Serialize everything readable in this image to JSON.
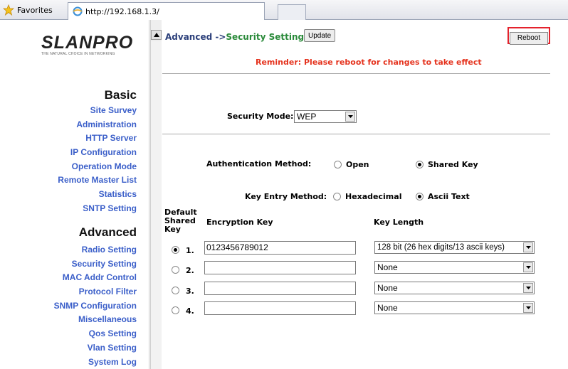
{
  "browser": {
    "favorites_label": "Favorites",
    "tab_url": "http://192.168.1.3/"
  },
  "logo": {
    "name": "SLANPRO",
    "tagline": "THE NATURAL CHOICE IN NETWORKING"
  },
  "sidebar": {
    "basic_heading": "Basic",
    "basic_items": [
      "Site Survey",
      "Administration",
      "HTTP Server",
      "IP Configuration",
      "Operation Mode",
      "Remote Master List",
      "Statistics",
      "SNTP Setting"
    ],
    "advanced_heading": "Advanced",
    "advanced_items": [
      "Radio Setting",
      "Security Setting",
      "MAC Addr Control",
      "Protocol Filter",
      "SNMP Configuration",
      "Miscellaneous",
      "Qos Setting",
      "Vlan Setting",
      "System Log"
    ]
  },
  "header": {
    "crumb_parent": "Advanced ->",
    "crumb_current": "Security Setting",
    "update_label": "Update",
    "reboot_label": "Reboot",
    "reminder": "Reminder: Please reboot for changes to take effect"
  },
  "security_mode": {
    "label": "Security Mode:",
    "value": "WEP"
  },
  "auth": {
    "label": "Authentication Method:",
    "open_label": "Open",
    "shared_label": "Shared Key",
    "selected": "Shared Key"
  },
  "key_entry": {
    "label": "Key Entry Method:",
    "hex_label": "Hexadecimal",
    "ascii_label": "Ascii Text",
    "selected": "Ascii Text"
  },
  "keys_table": {
    "col_default": [
      "Default",
      "Shared",
      "Key"
    ],
    "col_encryption": "Encryption Key",
    "col_length": "Key Length",
    "rows": [
      {
        "num": "1.",
        "key": "0123456789012",
        "length": "128 bit (26 hex digits/13 ascii keys)",
        "default": true
      },
      {
        "num": "2.",
        "key": "",
        "length": "None",
        "default": false
      },
      {
        "num": "3.",
        "key": "",
        "length": "None",
        "default": false
      },
      {
        "num": "4.",
        "key": "",
        "length": "None",
        "default": false
      }
    ]
  },
  "colors": {
    "link_blue": "#3b5fc9",
    "reminder_red": "#e5341f",
    "reboot_highlight": "#e4222c",
    "crumb_green": "#2a8a3a"
  }
}
